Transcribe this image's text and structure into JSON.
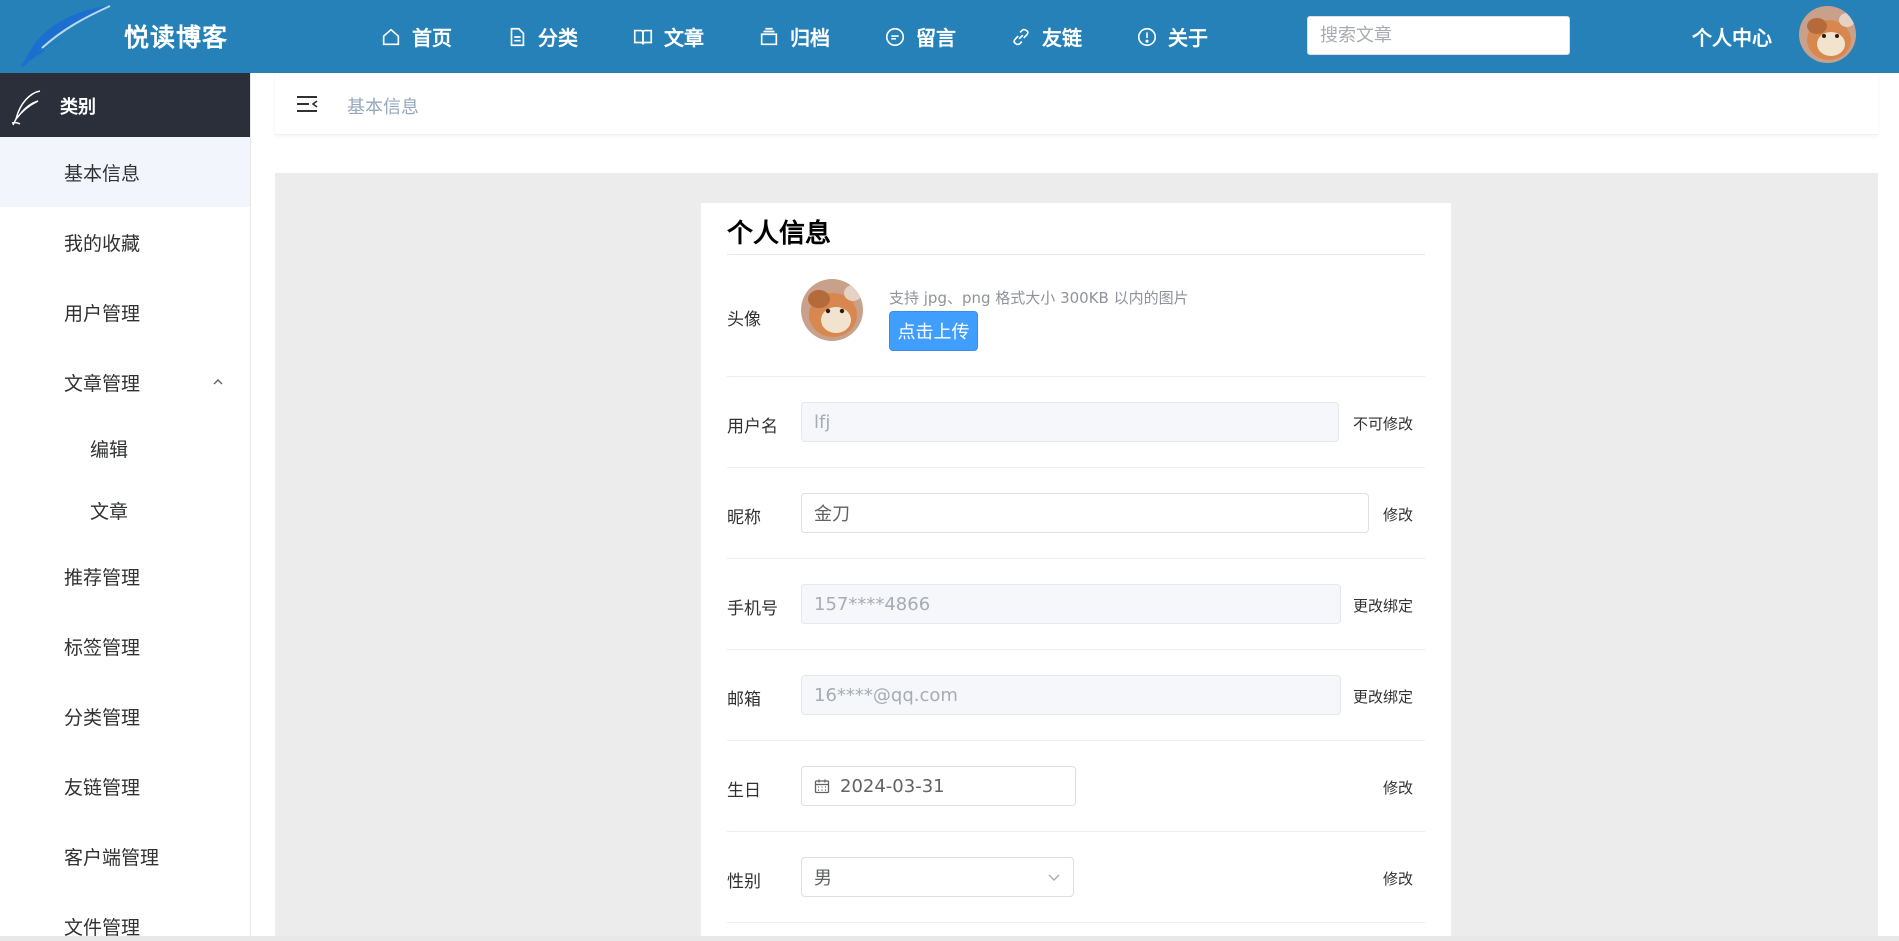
{
  "header": {
    "brand": "悦读博客",
    "nav": [
      {
        "label": "首页",
        "icon": "home-icon"
      },
      {
        "label": "分类",
        "icon": "document-icon"
      },
      {
        "label": "文章",
        "icon": "book-icon"
      },
      {
        "label": "归档",
        "icon": "archive-icon"
      },
      {
        "label": "留言",
        "icon": "message-icon"
      },
      {
        "label": "友链",
        "icon": "link-icon"
      },
      {
        "label": "关于",
        "icon": "info-icon"
      }
    ],
    "search_placeholder": "搜索文章",
    "user_center": "个人中心",
    "colors": {
      "topbar": "#2581b8",
      "accent": "#409eff"
    }
  },
  "sidebar": {
    "title": "类别",
    "items": [
      {
        "label": "基本信息"
      },
      {
        "label": "我的收藏"
      },
      {
        "label": "用户管理"
      },
      {
        "label": "文章管理"
      },
      {
        "label": "编辑"
      },
      {
        "label": "文章"
      },
      {
        "label": "推荐管理"
      },
      {
        "label": "标签管理"
      },
      {
        "label": "分类管理"
      },
      {
        "label": "友链管理"
      },
      {
        "label": "客户端管理"
      },
      {
        "label": "文件管理"
      }
    ]
  },
  "breadcrumb": {
    "current": "基本信息"
  },
  "profile": {
    "title": "个人信息",
    "avatar": {
      "label": "头像",
      "tip": "支持 jpg、png 格式大小 300KB 以内的图片",
      "upload": "点击上传"
    },
    "username": {
      "label": "用户名",
      "value": "lfj",
      "action": "不可修改"
    },
    "nickname": {
      "label": "昵称",
      "value": "金刀",
      "action": "修改"
    },
    "phone": {
      "label": "手机号",
      "value": "157****4866",
      "action": "更改绑定"
    },
    "email": {
      "label": "邮箱",
      "value": "16****@qq.com",
      "action": "更改绑定"
    },
    "birthday": {
      "label": "生日",
      "value": "2024-03-31",
      "action": "修改"
    },
    "gender": {
      "label": "性别",
      "value": "男",
      "action": "修改"
    }
  }
}
